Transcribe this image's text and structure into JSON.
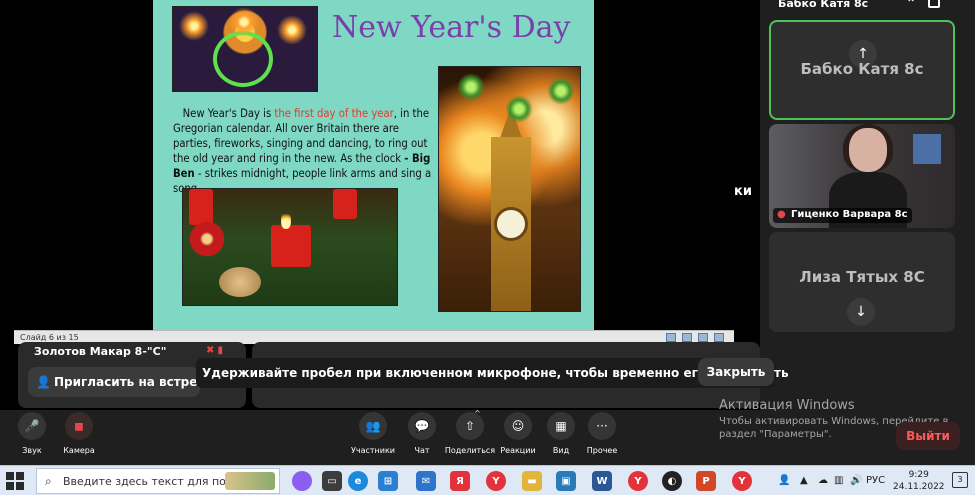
{
  "slide": {
    "title": "New Year's Day",
    "text_1": "New Year's Day is ",
    "text_hl": "the first day of the year",
    "text_2": ", in the Gregorian calendar. All over Britain there are parties, fireworks, singing and dancing, to ring out the old year and ring in the new. As the clock ",
    "text_bold": "- Big Ben",
    "text_3": " - strikes midnight, people link arms and sing a song.",
    "status": "Слайд 6 из 15"
  },
  "participants": {
    "header_name": "Бабко Катя 8с",
    "tile1_name": "Бабко Катя 8с",
    "tile2_name": "Гиценко Варвара 8с",
    "tile3_name": "Лиза Тятых 8С",
    "row_name": "Золотов Макар 8-\"С\"",
    "side_text": "ки"
  },
  "invite": {
    "label": "Пригласить на встре"
  },
  "notice": {
    "text": "Удерживайте пробел при включенном микрофоне, чтобы временно его выключить",
    "close": "Закрыть"
  },
  "activation": {
    "line1": "Активация Windows",
    "line2": "Чтобы активировать Windows, перейдите в раздел \"Параметры\"."
  },
  "leave": "Выйти",
  "controls": {
    "sound": "Звук",
    "camera": "Камера",
    "participants": "Участники",
    "chat": "Чат",
    "share": "Поделиться",
    "reactions": "Реакции",
    "view": "Вид",
    "more": "Прочее"
  },
  "taskbar": {
    "search_placeholder": "Введите здесь текст для поиска",
    "lang": "РУС",
    "time": "9:29",
    "date": "24.11.2022",
    "notifications": "3"
  },
  "colors": {
    "slide_bg": "#7fd8c4",
    "title": "#7a3fa8",
    "highlight": "#e23b2b",
    "active_speaker": "#4fc158",
    "danger": "#e2474b"
  }
}
